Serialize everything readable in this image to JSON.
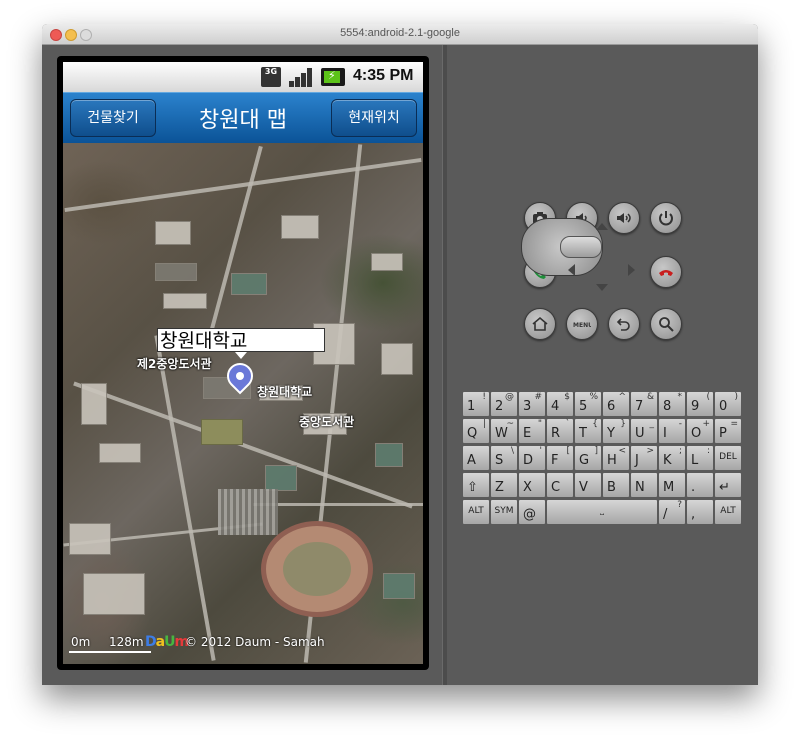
{
  "window": {
    "title": "5554:android-2.1-google"
  },
  "status_bar": {
    "network": "3G",
    "battery_glyph": "⚡",
    "time": "4:35 PM"
  },
  "app_bar": {
    "left_button": "건물찾기",
    "title": "창원대 맵",
    "right_button": "현재위치"
  },
  "map": {
    "callout": "창원대학교",
    "labels": {
      "library2": "제2중앙도서관",
      "university": "창원대학교",
      "library": "중앙도서관"
    },
    "scale": {
      "start": "0m",
      "end": "128m"
    },
    "logo": [
      "D",
      "a",
      "U",
      "m"
    ],
    "copyright": "© 2012 Daum - Samah"
  },
  "keyboard": {
    "row1": [
      {
        "main": "1",
        "alt": "!"
      },
      {
        "main": "2",
        "alt": "@"
      },
      {
        "main": "3",
        "alt": "#"
      },
      {
        "main": "4",
        "alt": "$"
      },
      {
        "main": "5",
        "alt": "%"
      },
      {
        "main": "6",
        "alt": "^"
      },
      {
        "main": "7",
        "alt": "&"
      },
      {
        "main": "8",
        "alt": "*"
      },
      {
        "main": "9",
        "alt": "("
      },
      {
        "main": "0",
        "alt": ")"
      }
    ],
    "row2": [
      {
        "main": "Q",
        "alt": "|"
      },
      {
        "main": "W",
        "alt": "~"
      },
      {
        "main": "E",
        "alt": "\""
      },
      {
        "main": "R",
        "alt": "`"
      },
      {
        "main": "T",
        "alt": "{"
      },
      {
        "main": "Y",
        "alt": "}"
      },
      {
        "main": "U",
        "alt": "_"
      },
      {
        "main": "I",
        "alt": "-"
      },
      {
        "main": "O",
        "alt": "+"
      },
      {
        "main": "P",
        "alt": "="
      }
    ],
    "row3": [
      {
        "main": "A",
        "alt": ""
      },
      {
        "main": "S",
        "alt": "\\"
      },
      {
        "main": "D",
        "alt": "'"
      },
      {
        "main": "F",
        "alt": "["
      },
      {
        "main": "G",
        "alt": "]"
      },
      {
        "main": "H",
        "alt": "<"
      },
      {
        "main": "J",
        "alt": ">"
      },
      {
        "main": "K",
        "alt": ";"
      },
      {
        "main": "L",
        "alt": ":"
      },
      {
        "main": "DEL",
        "alt": ""
      }
    ],
    "row4": [
      {
        "main": "⇧",
        "alt": ""
      },
      {
        "main": "Z",
        "alt": ""
      },
      {
        "main": "X",
        "alt": ""
      },
      {
        "main": "C",
        "alt": ""
      },
      {
        "main": "V",
        "alt": ""
      },
      {
        "main": "B",
        "alt": ""
      },
      {
        "main": "N",
        "alt": ""
      },
      {
        "main": "M",
        "alt": ""
      },
      {
        "main": ".",
        "alt": ""
      },
      {
        "main": "↵",
        "alt": ""
      }
    ],
    "row5": {
      "alt_left": "ALT",
      "sym": "SYM",
      "at": "@",
      "space": "⎵",
      "slash": "/",
      "slash_alt": "?",
      "comma": ",",
      "alt_right": "ALT"
    }
  }
}
